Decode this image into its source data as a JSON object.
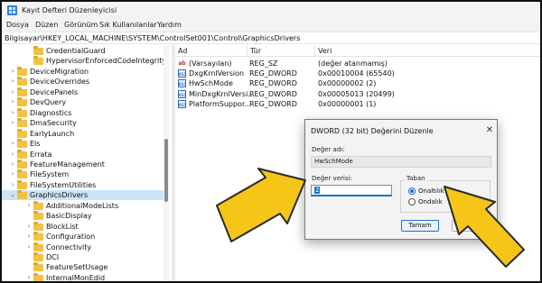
{
  "window": {
    "title": "Kayıt Defteri Düzenleyicisi"
  },
  "menu": [
    "Dosya",
    "Düzen",
    "Görünüm",
    "Sık Kullanılanlar",
    "Yardım"
  ],
  "address": "Bilgisayar\\HKEY_LOCAL_MACHINE\\SYSTEM\\ControlSet001\\Control\\GraphicsDrivers",
  "tree": [
    {
      "label": "CredentialGuard",
      "indent": 2,
      "expandable": false
    },
    {
      "label": "HypervisorEnforcedCodeIntegrity",
      "indent": 2,
      "expandable": false
    },
    {
      "label": "DeviceMigration",
      "indent": 1,
      "expandable": true
    },
    {
      "label": "DeviceOverrides",
      "indent": 1,
      "expandable": true
    },
    {
      "label": "DevicePanels",
      "indent": 1,
      "expandable": true
    },
    {
      "label": "DevQuery",
      "indent": 1,
      "expandable": true
    },
    {
      "label": "Diagnostics",
      "indent": 1,
      "expandable": true
    },
    {
      "label": "DmaSecurity",
      "indent": 1,
      "expandable": true
    },
    {
      "label": "EarlyLaunch",
      "indent": 1,
      "expandable": false
    },
    {
      "label": "Els",
      "indent": 1,
      "expandable": true
    },
    {
      "label": "Errata",
      "indent": 1,
      "expandable": true
    },
    {
      "label": "FeatureManagement",
      "indent": 1,
      "expandable": true
    },
    {
      "label": "FileSystem",
      "indent": 1,
      "expandable": true
    },
    {
      "label": "FileSystemUtilities",
      "indent": 1,
      "expandable": true
    },
    {
      "label": "GraphicsDrivers",
      "indent": 1,
      "expandable": true,
      "expanded": true,
      "selected": true
    },
    {
      "label": "AdditionalModeLists",
      "indent": 2,
      "expandable": true
    },
    {
      "label": "BasicDisplay",
      "indent": 2,
      "expandable": false
    },
    {
      "label": "BlockList",
      "indent": 2,
      "expandable": true
    },
    {
      "label": "Configuration",
      "indent": 2,
      "expandable": true
    },
    {
      "label": "Connectivity",
      "indent": 2,
      "expandable": true
    },
    {
      "label": "DCI",
      "indent": 2,
      "expandable": false
    },
    {
      "label": "FeatureSetUsage",
      "indent": 2,
      "expandable": false
    },
    {
      "label": "InternalMonEdid",
      "indent": 2,
      "expandable": true
    }
  ],
  "values": {
    "headers": [
      "Ad",
      "Tür",
      "Veri"
    ],
    "rows": [
      {
        "name": "(Varsayılan)",
        "type": "REG_SZ",
        "data": "(değer atanmamış)",
        "icon": "string-value-icon",
        "glyph": "ab"
      },
      {
        "name": "DxgKrnlVersion",
        "type": "REG_DWORD",
        "data": "0x00010004 (65540)",
        "icon": "dword-value-icon",
        "glyph": "011"
      },
      {
        "name": "HwSchMode",
        "type": "REG_DWORD",
        "data": "0x00000002 (2)",
        "icon": "dword-value-icon",
        "glyph": "011"
      },
      {
        "name": "MinDxgKrnlVersi...",
        "type": "REG_DWORD",
        "data": "0x00005013 (20499)",
        "icon": "dword-value-icon",
        "glyph": "011"
      },
      {
        "name": "PlatformSuppor...",
        "type": "REG_DWORD",
        "data": "0x00000001 (1)",
        "icon": "dword-value-icon",
        "glyph": "011"
      }
    ]
  },
  "dialog": {
    "title": "DWORD (32 bit) Değerini Düzenle",
    "close_glyph": "✕",
    "name_label": "Değer adı:",
    "name_value": "HwSchMode",
    "data_label": "Değer verisi:",
    "data_value": "2",
    "base_label": "Taban",
    "base_options": [
      "Onaltılık",
      "Ondalık"
    ],
    "base_selected": "Onaltılık",
    "ok_label": "Tamam",
    "cancel_label": "İptal"
  },
  "colors": {
    "arrow_fill": "#f5c518",
    "arrow_stroke": "#2a2a2a",
    "selection": "#cce4f7",
    "accent": "#1f6fd0"
  }
}
